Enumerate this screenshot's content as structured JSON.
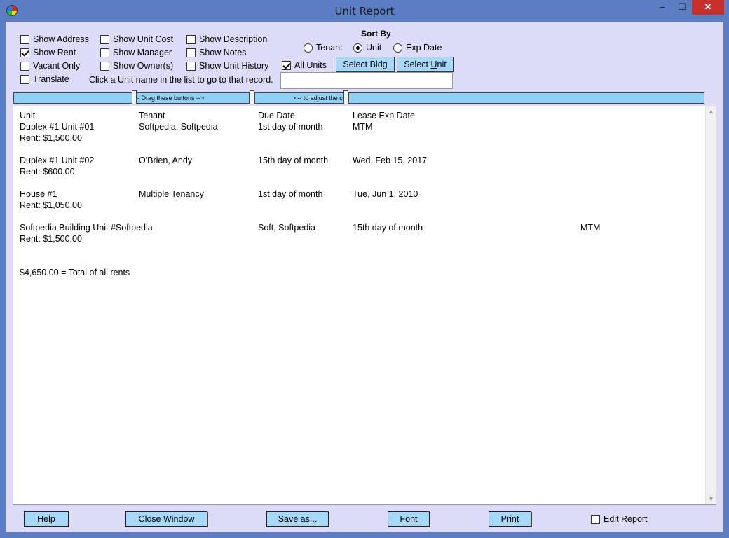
{
  "window": {
    "title": "Unit Report",
    "minimize": "–",
    "maximize": "☐",
    "close": "✕"
  },
  "options": {
    "show_address": "Show Address",
    "show_rent": "Show Rent",
    "vacant_only": "Vacant Only",
    "translate": "Translate",
    "show_unit_cost": "Show Unit Cost",
    "show_manager": "Show Manager",
    "show_owners": "Show Owner(s)",
    "show_description": "Show Description",
    "show_notes": "Show Notes",
    "show_unit_history": "Show Unit History",
    "all_units": "All Units",
    "hint": "Click a Unit name in the list to go to that record."
  },
  "sort": {
    "label": "Sort By",
    "tenant": "Tenant",
    "unit": "Unit",
    "exp_date": "Exp Date",
    "selected": "Unit"
  },
  "buttons": {
    "select_bldg": "Select Bldg",
    "select_unit_pre": "Select ",
    "select_unit_u": "U",
    "select_unit_post": "nit",
    "help": "Help",
    "close_window": "Close Window",
    "save_as": "Save as...",
    "font": "Font",
    "print": "Print",
    "edit_report": "Edit Report"
  },
  "column_bar": {
    "text1": "- Drag these buttons -->",
    "text2": "<-- to adjust the columns."
  },
  "report": {
    "headers": [
      "Unit",
      "Tenant",
      "Due Date",
      "Lease Exp Date"
    ],
    "rows": [
      {
        "unit": "Duplex #1 Unit #01",
        "tenant": "Softpedia, Softpedia",
        "due": "1st day of month",
        "exp": "MTM",
        "extra": "",
        "rent": "Rent: $1,500.00"
      },
      {
        "unit": "Duplex #1 Unit #02",
        "tenant": "O'Brien, Andy",
        "due": "15th day of month",
        "exp": "Wed, Feb 15, 2017",
        "extra": "",
        "rent": "Rent: $600.00"
      },
      {
        "unit": "House #1",
        "tenant": "Multiple Tenancy",
        "due": "1st day of month",
        "exp": "Tue, Jun 1, 2010",
        "extra": "",
        "rent": "Rent: $1,050.00"
      },
      {
        "unit": "Softpedia Building Unit #Softpedia",
        "tenant": "",
        "due": "Soft, Softpedia",
        "exp": "15th day of month",
        "extra": "MTM",
        "rent": "Rent: $1,500.00"
      }
    ],
    "total": "$4,650.00 = Total of all rents"
  }
}
